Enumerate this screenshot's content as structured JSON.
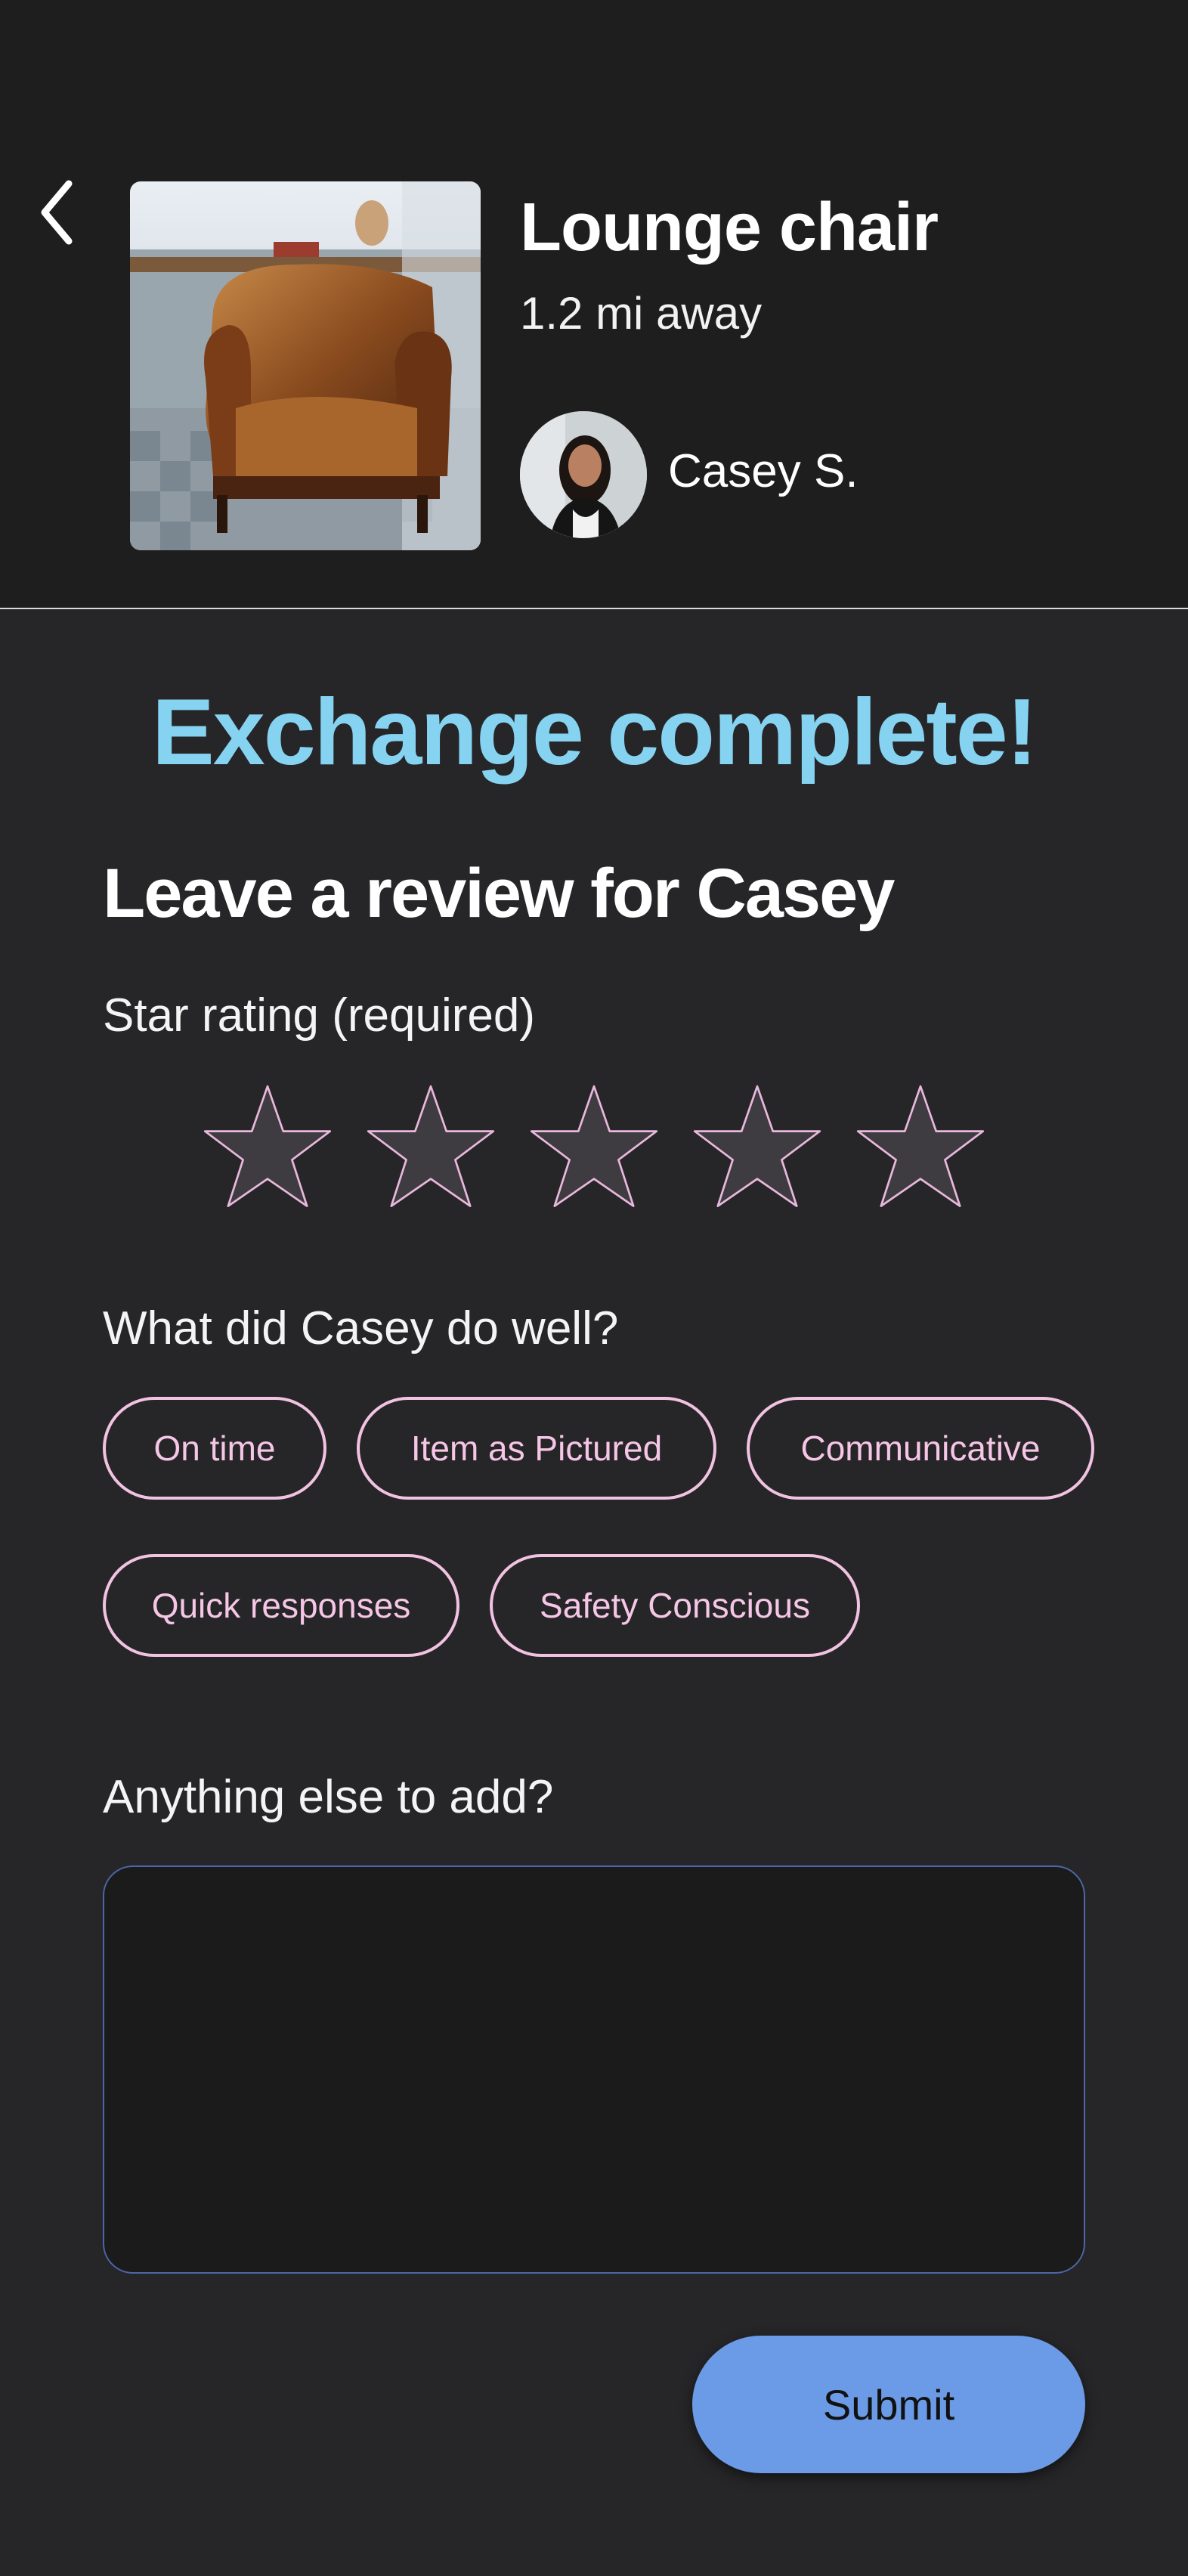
{
  "header": {
    "back_icon": "chevron-left-icon",
    "product_title": "Lounge chair",
    "product_distance": "1.2 mi away",
    "seller_name": "Casey S."
  },
  "main": {
    "status_title": "Exchange complete!",
    "review_heading": "Leave a review for Casey",
    "star_label": "Star rating (required)",
    "star_rating": 0,
    "star_max": 5,
    "praise_label": "What did Casey do well?",
    "tags": [
      "On time",
      "Item as Pictured",
      "Communicative",
      "Quick responses",
      "Safety Conscious"
    ],
    "comment_label": "Anything else to add?",
    "comment_value": "",
    "submit_label": "Submit"
  },
  "colors": {
    "accent_title": "#86d3f1",
    "chip_outline": "#f2c2e2",
    "submit_bg": "#6b9be6",
    "header_bg": "#1e1e1e",
    "page_bg": "#262628"
  }
}
